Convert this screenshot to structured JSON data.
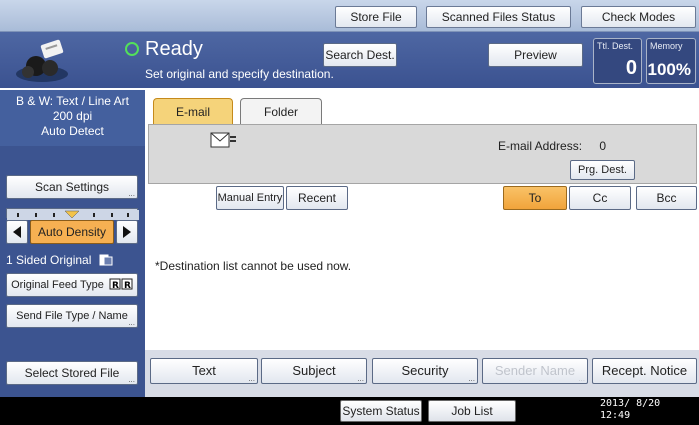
{
  "topbar": {
    "store_file": "Store File",
    "scanned_files_status": "Scanned Files Status",
    "check_modes": "Check Modes"
  },
  "header": {
    "status": "Ready",
    "message": "Set original and specify destination.",
    "search_dest": "Search Dest.",
    "preview": "Preview",
    "total_dest_label": "Ttl. Dest.",
    "total_dest_value": "0",
    "memory_label": "Memory",
    "memory_value": "100%"
  },
  "left_panel": {
    "scan_info_line1": "B & W: Text / Line Art",
    "scan_info_line2": "200 dpi",
    "scan_info_line3": "Auto Detect",
    "scan_settings": "Scan Settings",
    "auto_density": "Auto Density",
    "sided_original": "1 Sided Original",
    "original_feed_type": "Original Feed Type",
    "send_file_type": "Send File Type / Name",
    "select_stored_file": "Select Stored File"
  },
  "tabs": {
    "email": "E-mail",
    "folder": "Folder"
  },
  "address": {
    "label": "E-mail Address:",
    "count": "0",
    "prg_dest": "Prg. Dest."
  },
  "entry": {
    "manual_entry": "Manual Entry",
    "recent": "Recent",
    "to": "To",
    "cc": "Cc",
    "bcc": "Bcc"
  },
  "notice": "*Destination list cannot be used now.",
  "bottom": {
    "text": "Text",
    "subject": "Subject",
    "security": "Security",
    "sender_name": "Sender Name",
    "recept_notice": "Recept. Notice"
  },
  "footer": {
    "system_status": "System Status",
    "job_list": "Job List",
    "date": "2013/ 8/20",
    "time": "12:49"
  },
  "colors": {
    "header_blue": "#3b5290",
    "active_tab": "#f5d37a",
    "selected_orange": "#f1a43b",
    "ready_green": "#53e05a"
  }
}
